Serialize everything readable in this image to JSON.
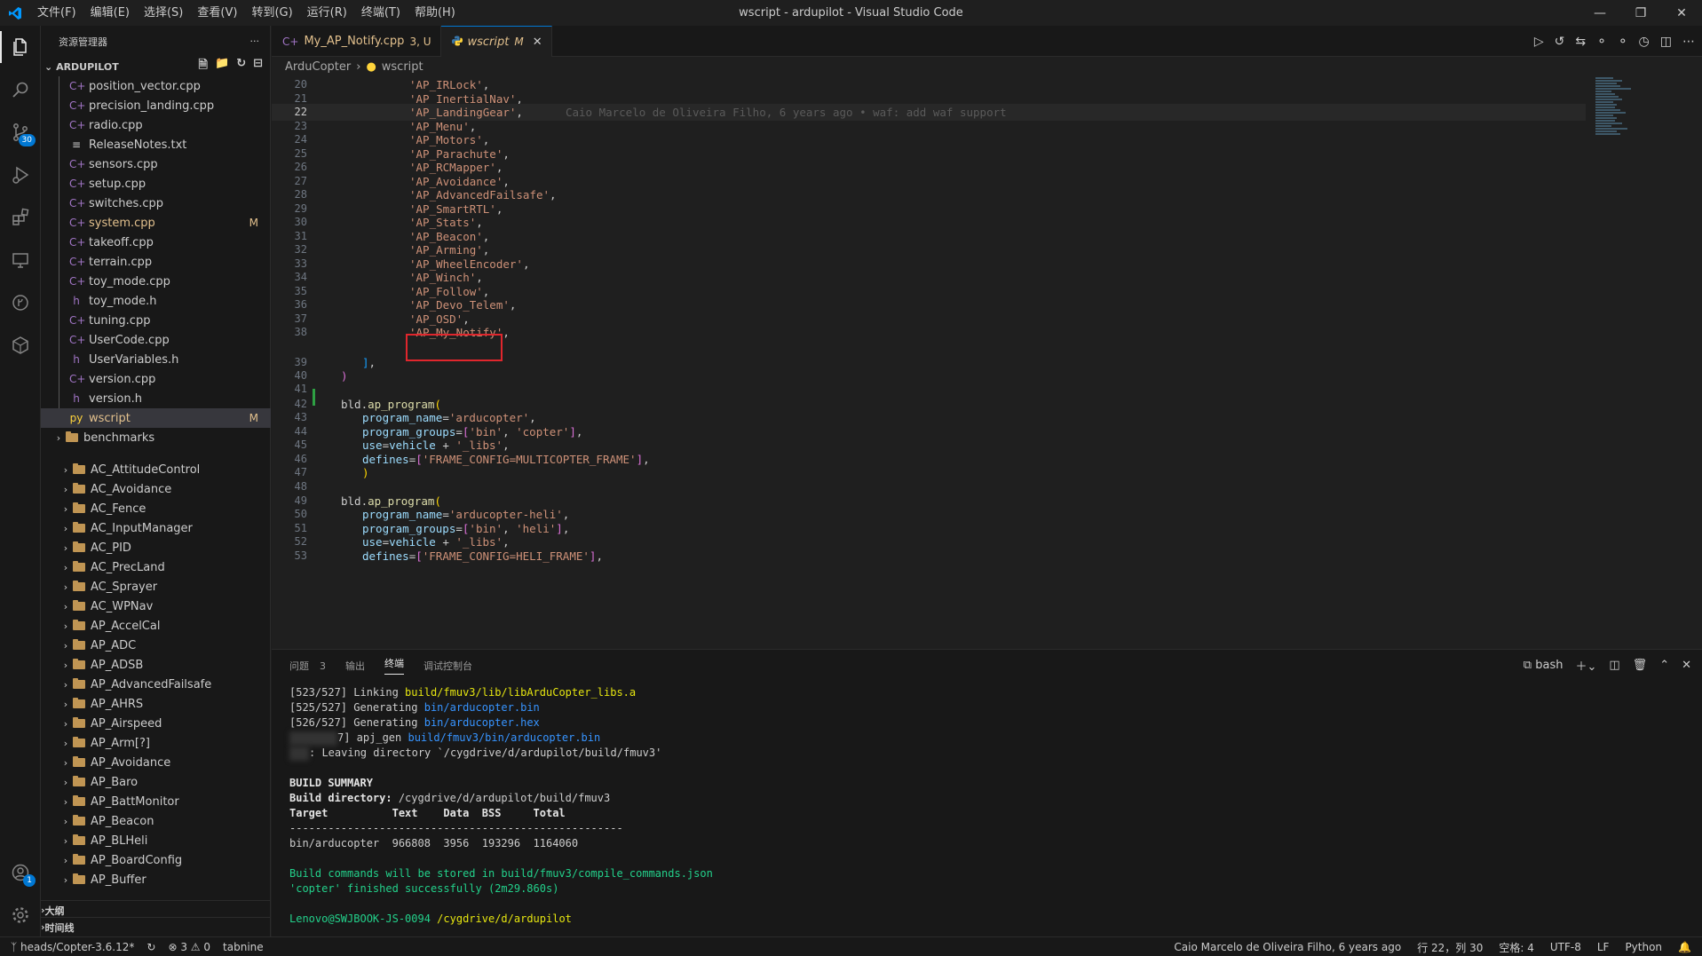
{
  "window": {
    "title": "wscript - ardupilot - Visual Studio Code",
    "menu": [
      "文件(F)",
      "编辑(E)",
      "选择(S)",
      "查看(V)",
      "转到(G)",
      "运行(R)",
      "终端(T)",
      "帮助(H)"
    ]
  },
  "activity": {
    "scm_badge": "30",
    "accounts_badge": "1"
  },
  "sidebar": {
    "header": "资源管理器",
    "more": "···",
    "project": "ARDUPILOT",
    "files": [
      {
        "name": "position_vector.cpp",
        "type": "cpp",
        "badge": ""
      },
      {
        "name": "precision_landing.cpp",
        "type": "cpp",
        "badge": ""
      },
      {
        "name": "radio.cpp",
        "type": "cpp",
        "badge": ""
      },
      {
        "name": "ReleaseNotes.txt",
        "type": "txt",
        "badge": ""
      },
      {
        "name": "sensors.cpp",
        "type": "cpp",
        "badge": ""
      },
      {
        "name": "setup.cpp",
        "type": "cpp",
        "badge": ""
      },
      {
        "name": "switches.cpp",
        "type": "cpp",
        "badge": ""
      },
      {
        "name": "system.cpp",
        "type": "cpp",
        "badge": "M"
      },
      {
        "name": "takeoff.cpp",
        "type": "cpp",
        "badge": ""
      },
      {
        "name": "terrain.cpp",
        "type": "cpp",
        "badge": ""
      },
      {
        "name": "toy_mode.cpp",
        "type": "cpp",
        "badge": ""
      },
      {
        "name": "toy_mode.h",
        "type": "h",
        "badge": ""
      },
      {
        "name": "tuning.cpp",
        "type": "cpp",
        "badge": ""
      },
      {
        "name": "UserCode.cpp",
        "type": "cpp",
        "badge": ""
      },
      {
        "name": "UserVariables.h",
        "type": "h",
        "badge": ""
      },
      {
        "name": "version.cpp",
        "type": "cpp",
        "badge": ""
      },
      {
        "name": "version.h",
        "type": "h",
        "badge": ""
      },
      {
        "name": "wscript",
        "type": "py",
        "badge": "M"
      }
    ],
    "benchmarks": "benchmarks",
    "folders": [
      "AC_AttitudeControl",
      "AC_Avoidance",
      "AC_Fence",
      "AC_InputManager",
      "AC_PID",
      "AC_PrecLand",
      "AC_Sprayer",
      "AC_WPNav",
      "AP_AccelCal",
      "AP_ADC",
      "AP_ADSB",
      "AP_AdvancedFailsafe",
      "AP_AHRS",
      "AP_Airspeed",
      "AP_Arm[?]",
      "AP_Avoidance",
      "AP_Baro",
      "AP_BattMonitor",
      "AP_Beacon",
      "AP_BLHeli",
      "AP_BoardConfig",
      "AP_Buffer"
    ],
    "outline": "大纲",
    "timeline": "时间线"
  },
  "tabs": [
    {
      "name": "My_AP_Notify.cpp",
      "meta": "3, U",
      "icon": "C++"
    },
    {
      "name": "wscript",
      "meta": "M",
      "icon": "python-icon"
    }
  ],
  "breadcrumb": {
    "folder": "ArduCopter",
    "file": "wscript"
  },
  "editor": {
    "blame": "Caio Marcelo de Oliveira Filho, 6 years ago • waf: add waf support",
    "lines": [
      {
        "n": "20",
        "s": "'AP_IRLock'"
      },
      {
        "n": "21",
        "s": "'AP_InertialNav'"
      },
      {
        "n": "22",
        "s": "'AP_LandingGear'"
      },
      {
        "n": "23",
        "s": "'AP_Menu'"
      },
      {
        "n": "24",
        "s": "'AP_Motors'"
      },
      {
        "n": "25",
        "s": "'AP_Parachute'"
      },
      {
        "n": "26",
        "s": "'AP_RCMapper'"
      },
      {
        "n": "27",
        "s": "'AP_Avoidance'"
      },
      {
        "n": "28",
        "s": "'AP_AdvancedFailsafe'"
      },
      {
        "n": "29",
        "s": "'AP_SmartRTL'"
      },
      {
        "n": "30",
        "s": "'AP_Stats'"
      },
      {
        "n": "31",
        "s": "'AP_Beacon'"
      },
      {
        "n": "32",
        "s": "'AP_Arming'"
      },
      {
        "n": "33",
        "s": "'AP_WheelEncoder'"
      },
      {
        "n": "34",
        "s": "'AP_Winch'"
      },
      {
        "n": "35",
        "s": "'AP_Follow'"
      },
      {
        "n": "36",
        "s": "'AP_Devo_Telem'"
      },
      {
        "n": "37",
        "s": "'AP_OSD'"
      },
      {
        "n": "38",
        "s": "'AP_My_Notify'"
      }
    ],
    "ln39": "39",
    "ln40": "40",
    "ln41": "41",
    "bld1": {
      "n42": "42",
      "call": "bld.ap_program(",
      "n43": "43",
      "k43": "program_name",
      "v43": "'arducopter'",
      "n44": "44",
      "k44": "program_groups",
      "v44a": "'bin'",
      "v44b": "'copter'",
      "n45": "45",
      "k45": "use",
      "v45a": "vehicle",
      "v45b": "'_libs'",
      "n46": "46",
      "k46": "defines",
      "v46": "'FRAME_CONFIG=MULTICOPTER_FRAME'",
      "n47": "47"
    },
    "ln48": "48",
    "bld2": {
      "n49": "49",
      "call": "bld.ap_program(",
      "n50": "50",
      "k50": "program_name",
      "v50": "'arducopter-heli'",
      "n51": "51",
      "k51": "program_groups",
      "v51a": "'bin'",
      "v51b": "'heli'",
      "n52": "52",
      "k52": "use",
      "v52a": "vehicle",
      "v52b": "'_libs'",
      "n53": "53",
      "k53": "defines",
      "v53": "'FRAME_CONFIG=HELI_FRAME'"
    }
  },
  "panel": {
    "tabs": [
      "问题",
      "输出",
      "终端",
      "调试控制台"
    ],
    "problems_count": "3",
    "shell": "bash",
    "terminal": {
      "l1a": "[523/527] Linking ",
      "l1b": "build/fmuv3/lib/libArduCopter_libs.a",
      "l2a": "[525/527] Generating ",
      "l2b": "bin/arducopter.bin",
      "l3a": "[526/527] Generating ",
      "l3b": "bin/arducopter.hex",
      "l4a": "7] apj_gen ",
      "l4b": "build/fmuv3/bin/arducopter.bin",
      "l5": ": Leaving directory `/cygdrive/d/ardupilot/build/fmuv3'",
      "summary": "BUILD SUMMARY",
      "bdir_label": "Build directory:",
      "bdir": " /cygdrive/d/ardupilot/build/fmuv3",
      "thead": "Target          Text    Data  BSS     Total",
      "dashes": "----------------------------------------------------",
      "row": "bin/arducopter  966808  3956  193296  1164060",
      "cmds": "Build commands will be stored in build/fmuv3/compile_commands.json",
      "done": "'copter' finished successfully (2m29.860s)",
      "prompt_user": "Lenovo@SWJBOOK-JS-0094",
      "prompt_path": " /cygdrive/d/ardupilot"
    }
  },
  "status": {
    "branch": "heads/Copter-3.6.12*",
    "errors": "3",
    "warnings": "0",
    "tabnine": "tabnine",
    "blame": "Caio Marcelo de Oliveira Filho, 6 years ago",
    "position": "行 22，列 30",
    "spaces": "空格: 4",
    "encoding": "UTF-8",
    "eol": "LF",
    "language": "Python"
  },
  "colors": {
    "accent": "#0078d4",
    "highlight_box": "#e0262d",
    "modified": "#e2c08d",
    "string": "#ce9178"
  }
}
